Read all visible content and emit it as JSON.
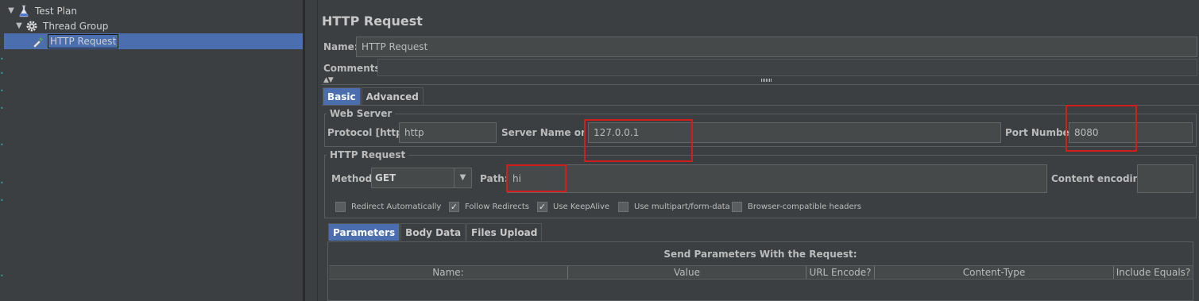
{
  "tree": {
    "items": [
      {
        "label": "Test Plan",
        "icon": "flask-icon"
      },
      {
        "label": "Thread Group",
        "icon": "gear-icon"
      },
      {
        "label": "HTTP Request",
        "icon": "pipette-icon",
        "selected": true
      }
    ]
  },
  "panel": {
    "title": "HTTP Request",
    "name_label": "Name:",
    "name_value": "HTTP Request",
    "comments_label": "Comments:",
    "tabs": [
      {
        "label": "Basic",
        "active": true
      },
      {
        "label": "Advanced",
        "active": false
      }
    ],
    "web_server": {
      "title": "Web Server",
      "protocol_label": "Protocol [http]:",
      "protocol_value": "http",
      "server_label": "Server Name or IP",
      "server_value": "127.0.0.1",
      "port_label": "Port Number:",
      "port_value": "8080"
    },
    "http_request": {
      "title": "HTTP Request",
      "method_label": "Method:",
      "method_value": "GET",
      "path_label": "Path:",
      "path_value": "hi",
      "encoding_label": "Content encoding:",
      "encoding_value": ""
    },
    "checkboxes": [
      {
        "label": "Redirect Automatically",
        "checked": false
      },
      {
        "label": "Follow Redirects",
        "checked": true
      },
      {
        "label": "Use KeepAlive",
        "checked": true
      },
      {
        "label": "Use multipart/form-data",
        "checked": false
      },
      {
        "label": "Browser-compatible headers",
        "checked": false
      }
    ],
    "sub_tabs": [
      {
        "label": "Parameters",
        "active": true
      },
      {
        "label": "Body Data",
        "active": false
      },
      {
        "label": "Files Upload",
        "active": false
      }
    ],
    "params": {
      "title": "Send Parameters With the Request:",
      "columns": [
        "Name:",
        "Value",
        "URL Encode?",
        "Content-Type",
        "Include Equals?"
      ]
    }
  },
  "colors": {
    "background": "#3c3f41",
    "selection": "#4b6eaf",
    "highlight_box": "#d21d1d"
  }
}
